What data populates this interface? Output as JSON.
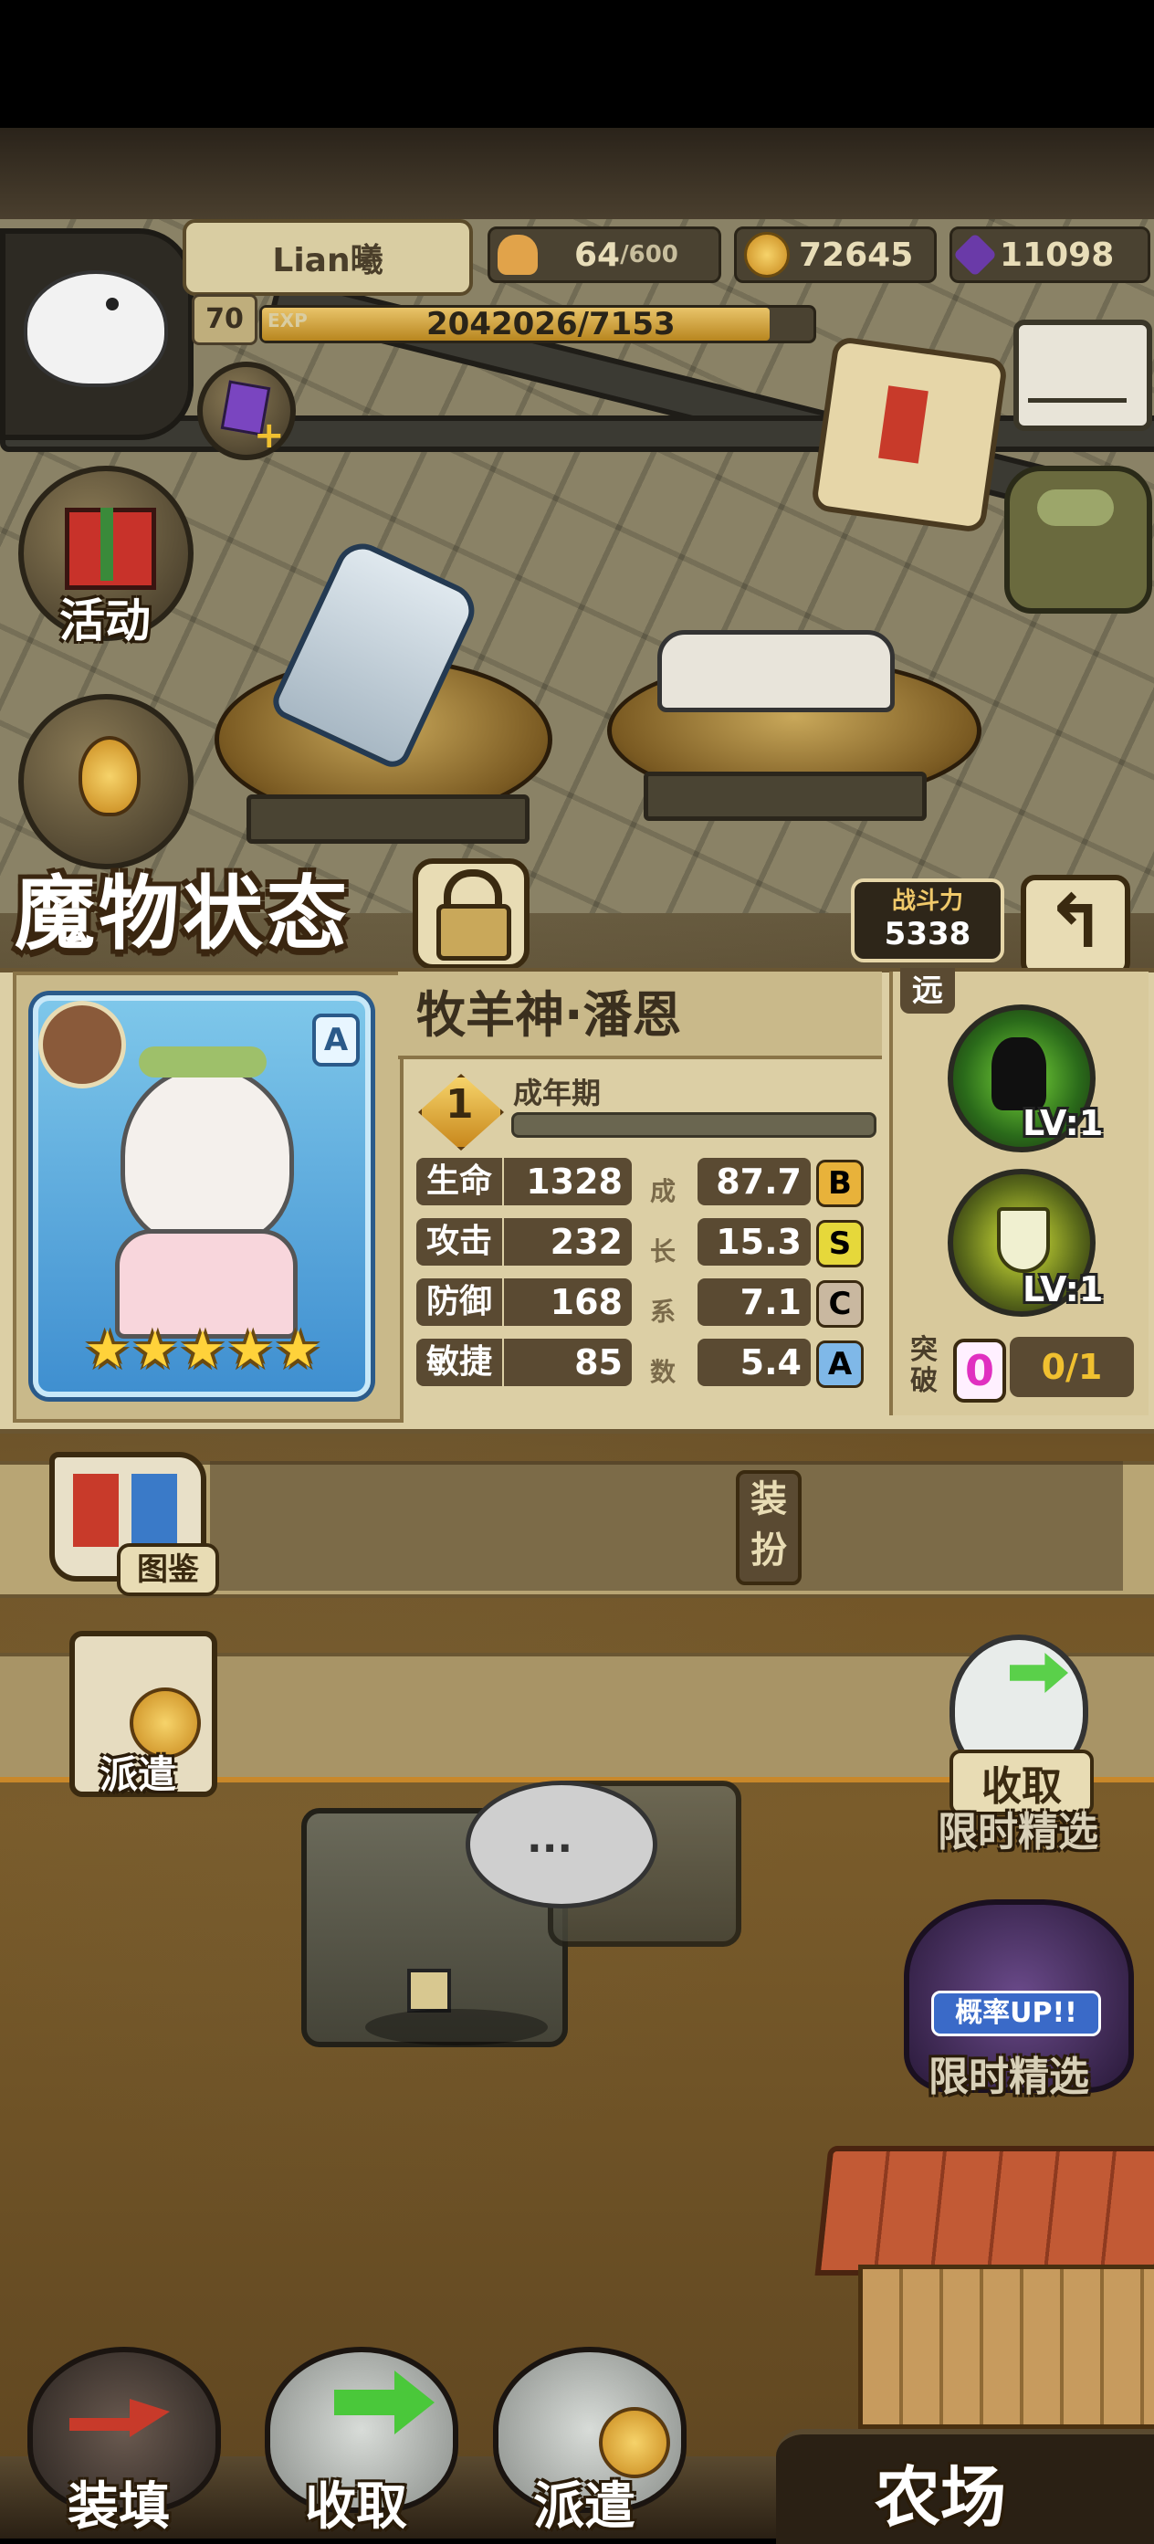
{
  "player": {
    "name": "Lian曦",
    "level": "70",
    "exp_label": "EXP",
    "exp_text": "2042026/7153",
    "exp_fraction": 0.92
  },
  "resources": {
    "bread": "64",
    "bread_max": "/600",
    "gold": "72645",
    "gems": "11098"
  },
  "icons": {
    "avatar": "white-ghost-monster",
    "bread": "bread-icon",
    "gold": "gold-coin-icon",
    "gem": "purple-gem-icon",
    "mail": "envelope-icon",
    "quest": "scroll-quill-icon",
    "bag": "backpack-icon",
    "lock": "padlock-icon",
    "back": "return-arrow-icon"
  },
  "side_buttons": {
    "activity": "活动",
    "atlas": "图鉴",
    "dispatch_side": "派遣",
    "collect_side": "收取",
    "limited_1": "限时精选",
    "limited_2": "限时精选",
    "rate_up": "概率UP!!"
  },
  "status": {
    "title": "魔物状态",
    "power_label": "战斗力",
    "power_value": "5338",
    "monster_name": "牧羊神·潘恩",
    "rank_badge": "A",
    "stars": 5,
    "stage_number": "1",
    "stage": "成年期",
    "range": "远",
    "growth_vertical": [
      "成",
      "长",
      "系",
      "数"
    ],
    "stats": [
      {
        "label": "生命",
        "value": "1328",
        "growth": "87.7",
        "grade": "B",
        "grade_color": "#e8b23a"
      },
      {
        "label": "攻击",
        "value": "232",
        "growth": "15.3",
        "grade": "S",
        "grade_color": "#e6d83a"
      },
      {
        "label": "防御",
        "value": "168",
        "growth": "7.1",
        "grade": "C",
        "grade_color": "#c9b8a0"
      },
      {
        "label": "敏捷",
        "value": "85",
        "growth": "5.4",
        "grade": "A",
        "grade_color": "#7fb8e8"
      }
    ],
    "skills": [
      {
        "lv": "LV:1",
        "icon": "shadow-skill-icon"
      },
      {
        "lv": "LV:1",
        "icon": "shield-skill-icon"
      }
    ],
    "breakthrough_label": [
      "突",
      "破"
    ],
    "breakthrough_count": "0",
    "breakthrough_progress": "0/1",
    "equip_label": [
      "装",
      "扮"
    ]
  },
  "bottom_bar": {
    "load": "装填",
    "collect": "收取",
    "dispatch": "派遣",
    "farm": "农场"
  },
  "colors": {
    "accent_gold": "#e9c46a",
    "panel_bg": "#dccfa5",
    "stat_bg": "#5a4a32"
  }
}
